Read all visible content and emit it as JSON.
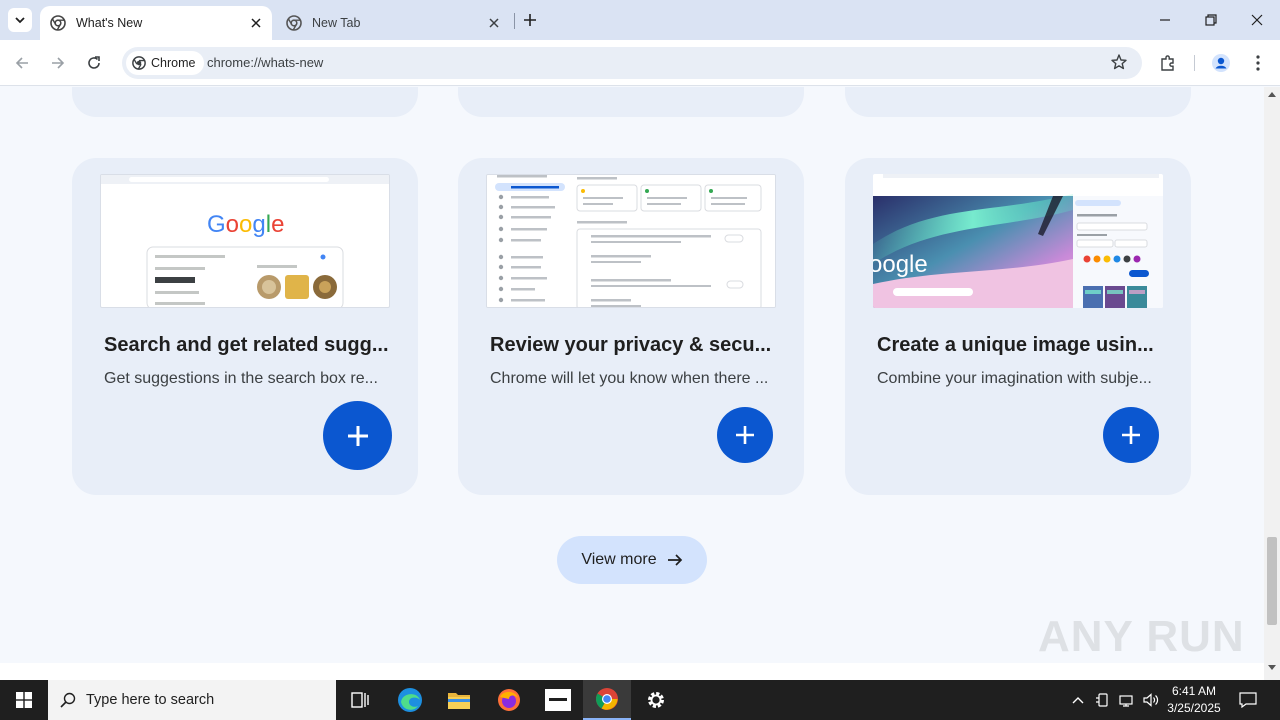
{
  "browser": {
    "tabs": [
      {
        "title": "What's New",
        "active": true
      },
      {
        "title": "New Tab",
        "active": false
      }
    ],
    "chip_label": "Chrome",
    "url": "chrome://whats-new"
  },
  "cards": [
    {
      "title": "Search and get related sugg...",
      "desc": "Get suggestions in the search box re..."
    },
    {
      "title": "Review your privacy & secu...",
      "desc": "Chrome will let you know when there ..."
    },
    {
      "title": "Create a unique image usin...",
      "desc": "Combine your imagination with subje..."
    }
  ],
  "thumbs": {
    "google_logo": "Google",
    "google_logo_partial": "oogle"
  },
  "view_more_label": "View more",
  "watermark": "ANY RUN",
  "taskbar": {
    "search_placeholder": "Type here to search",
    "time": "6:41 AM",
    "date": "3/25/2025"
  },
  "colors": {
    "accent": "#0b57d0",
    "card_bg": "#e8eef8",
    "tabstrip_bg": "#dae3f3",
    "view_more_bg": "#d3e3fd"
  }
}
